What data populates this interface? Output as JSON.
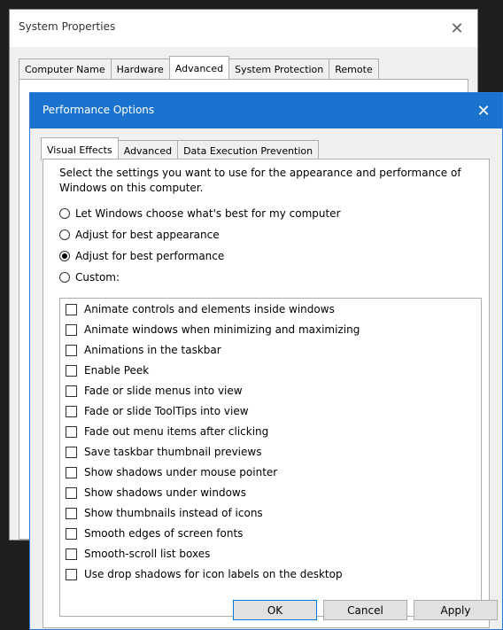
{
  "system_properties": {
    "title": "System Properties",
    "close_glyph": "✕",
    "tabs": [
      "Computer Name",
      "Hardware",
      "Advanced",
      "System Protection",
      "Remote"
    ],
    "active_tab": "Advanced"
  },
  "performance_options": {
    "title": "Performance Options",
    "close_glyph": "✕",
    "tabs": [
      "Visual Effects",
      "Advanced",
      "Data Execution Prevention"
    ],
    "active_tab": "Visual Effects",
    "description": "Select the settings you want to use for the appearance and performance of Windows on this computer.",
    "radio_options": [
      {
        "label": "Let Windows choose what's best for my computer",
        "checked": false
      },
      {
        "label": "Adjust for best appearance",
        "checked": false
      },
      {
        "label": "Adjust for best performance",
        "checked": true
      },
      {
        "label": "Custom:",
        "checked": false
      }
    ],
    "effects": [
      {
        "label": "Animate controls and elements inside windows",
        "checked": false
      },
      {
        "label": "Animate windows when minimizing and maximizing",
        "checked": false
      },
      {
        "label": "Animations in the taskbar",
        "checked": false
      },
      {
        "label": "Enable Peek",
        "checked": false
      },
      {
        "label": "Fade or slide menus into view",
        "checked": false
      },
      {
        "label": "Fade or slide ToolTips into view",
        "checked": false
      },
      {
        "label": "Fade out menu items after clicking",
        "checked": false
      },
      {
        "label": "Save taskbar thumbnail previews",
        "checked": false
      },
      {
        "label": "Show shadows under mouse pointer",
        "checked": false
      },
      {
        "label": "Show shadows under windows",
        "checked": false
      },
      {
        "label": "Show thumbnails instead of icons",
        "checked": false
      },
      {
        "label": "Smooth edges of screen fonts",
        "checked": false
      },
      {
        "label": "Smooth-scroll list boxes",
        "checked": false
      },
      {
        "label": "Use drop shadows for icon labels on the desktop",
        "checked": false
      }
    ],
    "buttons": {
      "ok": "OK",
      "cancel": "Cancel",
      "apply": "Apply"
    }
  }
}
